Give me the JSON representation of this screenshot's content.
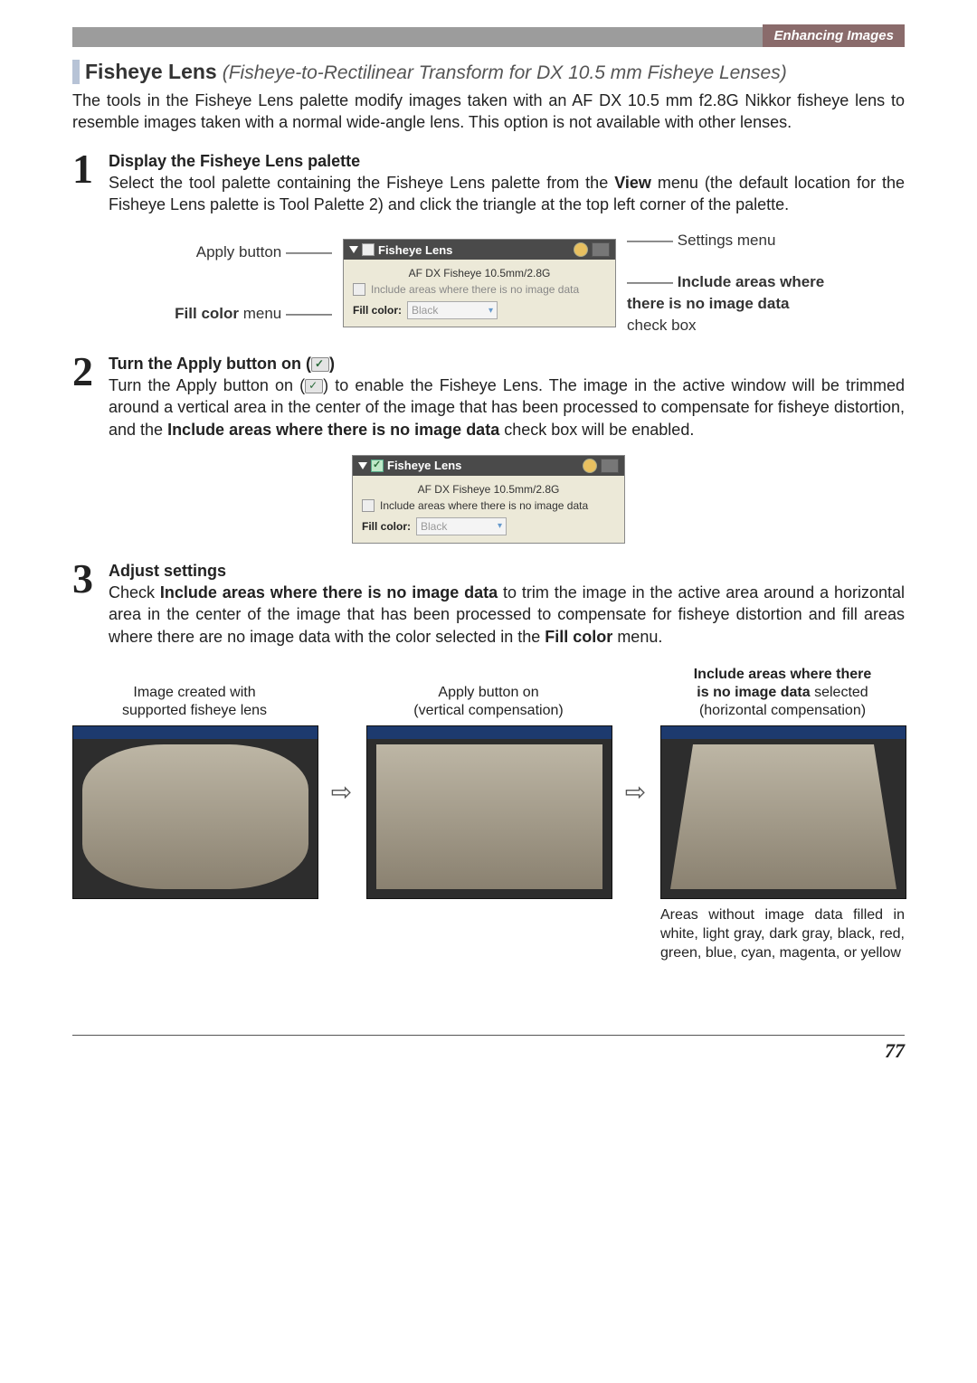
{
  "header": {
    "section": "Enhancing Images"
  },
  "title": {
    "bold": "Fisheye Lens",
    "italic": "(Fisheye-to-Rectilinear Transform for DX 10.5 mm Fisheye Lenses)"
  },
  "intro": "The tools in the Fisheye Lens palette modify images taken with an AF DX 10.5 mm f2.8G Nikkor fisheye lens to resemble images taken with a normal wide-angle lens. This option is not available with other lenses.",
  "steps": {
    "s1": {
      "num": "1",
      "heading": "Display the Fisheye Lens palette",
      "text_a": "Select the tool palette containing the Fisheye Lens palette from the ",
      "bold_a": "View",
      "text_b": " menu (the default location for the Fisheye Lens palette is Tool Palette 2) and click the triangle at the top left corner of the palette."
    },
    "s2": {
      "num": "2",
      "heading": "Turn the Apply button on (",
      "heading_end": ")",
      "text_a": "Turn the Apply button on (",
      "text_b": ") to enable the Fisheye Lens. The image in the active window will be trimmed around a vertical area in the center of the image that has been processed to compensate for fisheye distortion, and the ",
      "bold_a": "Include areas where there is no image data",
      "text_c": " check box will be enabled."
    },
    "s3": {
      "num": "3",
      "heading": "Adjust settings",
      "text_a": "Check ",
      "bold_a": "Include areas where there is no image data",
      "text_b": " to trim the image in the active area around a horizontal area in the center of the image that has been processed to compensate for fisheye distortion and fill areas where there are no image data with the color selected in the ",
      "bold_b": "Fill color",
      "text_c": " menu."
    }
  },
  "palette_labels": {
    "apply_button": "Apply button",
    "fill_color_menu_bold": "Fill color",
    "fill_color_menu_rest": " menu",
    "settings_menu": "Settings menu",
    "include_bold": "Include areas where there is no image data",
    "include_rest": " check box"
  },
  "palette": {
    "title": "Fisheye Lens",
    "lens": "AF DX Fisheye 10.5mm/2.8G",
    "checkbox_label": "Include areas where there is no image data",
    "fill_label": "Fill color:",
    "fill_value": "Black"
  },
  "samples": {
    "col1": {
      "line1": "Image created with",
      "line2": "supported fisheye lens"
    },
    "col2": {
      "line1": "Apply button on",
      "line2": "(vertical compensation)"
    },
    "col3": {
      "line1_bold": "Include areas where there",
      "line2_bold": "is no image data",
      "line2_rest": " selected",
      "line3": "(horizontal compensation)"
    },
    "caption3": "Areas without image data filled in white, light gray, dark gray, black, red, green, blue, cyan, magenta, or yellow"
  },
  "page_number": "77"
}
